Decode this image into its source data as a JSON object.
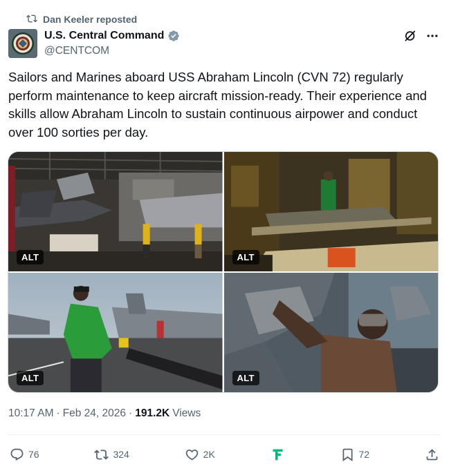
{
  "repost": {
    "text": "Dan Keeler reposted"
  },
  "author": {
    "name": "U.S. Central Command",
    "handle": "@CENTCOM"
  },
  "post": {
    "text": "Sailors and Marines aboard USS Abraham Lincoln (CVN 72) regularly perform maintenance to keep aircraft mission-ready. Their experience and skills allow Abraham Lincoln to sustain continuous airpower and conduct over 100 sorties per day."
  },
  "media": {
    "alt_label": "ALT"
  },
  "meta": {
    "time": "10:17 AM",
    "separator1": "·",
    "date": "Feb 24, 2026",
    "separator2": "·",
    "views_count": "191.2K",
    "views_label": "Views"
  },
  "actions": {
    "replies": "76",
    "reposts": "324",
    "likes": "2K",
    "bookmarks": "72"
  },
  "colors": {
    "text_primary": "#0f1419",
    "text_secondary": "#536471",
    "verified": "#829aab",
    "grok_green": "#00ba7c"
  },
  "icons": [
    "repost-icon",
    "verified-badge-icon",
    "grok-icon",
    "more-icon",
    "reply-icon",
    "like-icon",
    "bookmark-icon",
    "share-icon"
  ]
}
